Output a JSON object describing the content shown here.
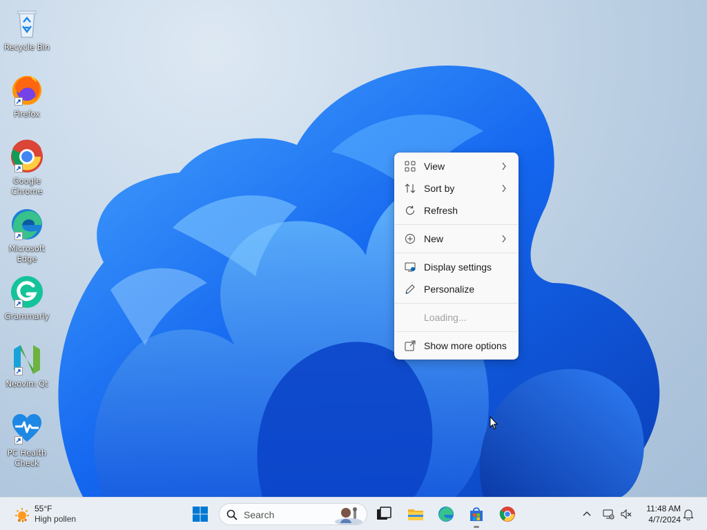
{
  "desktop": {
    "icons": [
      {
        "label": "Recycle Bin",
        "icon": "recycle-bin-icon"
      },
      {
        "label": "Firefox",
        "icon": "firefox-icon"
      },
      {
        "label": "Google Chrome",
        "icon": "chrome-icon"
      },
      {
        "label": "Microsoft Edge",
        "icon": "edge-icon"
      },
      {
        "label": "Grammarly",
        "icon": "grammarly-icon"
      },
      {
        "label": "Neovim Qt",
        "icon": "neovim-icon"
      },
      {
        "label": "PC Health Check",
        "icon": "pc-health-check-icon"
      }
    ]
  },
  "context_menu": {
    "items": [
      {
        "label": "View",
        "icon": "grid-icon",
        "submenu": true
      },
      {
        "label": "Sort by",
        "icon": "sort-icon",
        "submenu": true
      },
      {
        "label": "Refresh",
        "icon": "refresh-icon",
        "submenu": false
      },
      {
        "label": "New",
        "icon": "plus-circle-icon",
        "submenu": true
      },
      {
        "label": "Display settings",
        "icon": "display-settings-icon",
        "submenu": false
      },
      {
        "label": "Personalize",
        "icon": "pen-icon",
        "submenu": false
      },
      {
        "label": "Loading...",
        "icon": "",
        "submenu": false,
        "disabled": true
      },
      {
        "label": "Show more options",
        "icon": "open-external-icon",
        "submenu": false
      }
    ]
  },
  "taskbar": {
    "weather": {
      "temp": "55°F",
      "desc": "High pollen",
      "icon": "sun-icon"
    },
    "search": {
      "placeholder": "Search"
    },
    "apps": [
      {
        "name": "Start",
        "icon": "windows-logo-icon"
      },
      {
        "name": "Task View",
        "icon": "task-view-icon"
      },
      {
        "name": "File Explorer",
        "icon": "folder-icon"
      },
      {
        "name": "Microsoft Edge",
        "icon": "edge-icon"
      },
      {
        "name": "Microsoft Store",
        "icon": "store-icon"
      },
      {
        "name": "Google Chrome",
        "icon": "chrome-icon"
      }
    ],
    "clock": {
      "time": "11:48 AM",
      "date": "4/7/2024"
    }
  },
  "colors": {
    "accent": "#0067c0",
    "wallpaper_blue": "#1a5fe0",
    "taskbar_bg": "#e9eef4",
    "menu_bg": "#f9f9f9"
  }
}
